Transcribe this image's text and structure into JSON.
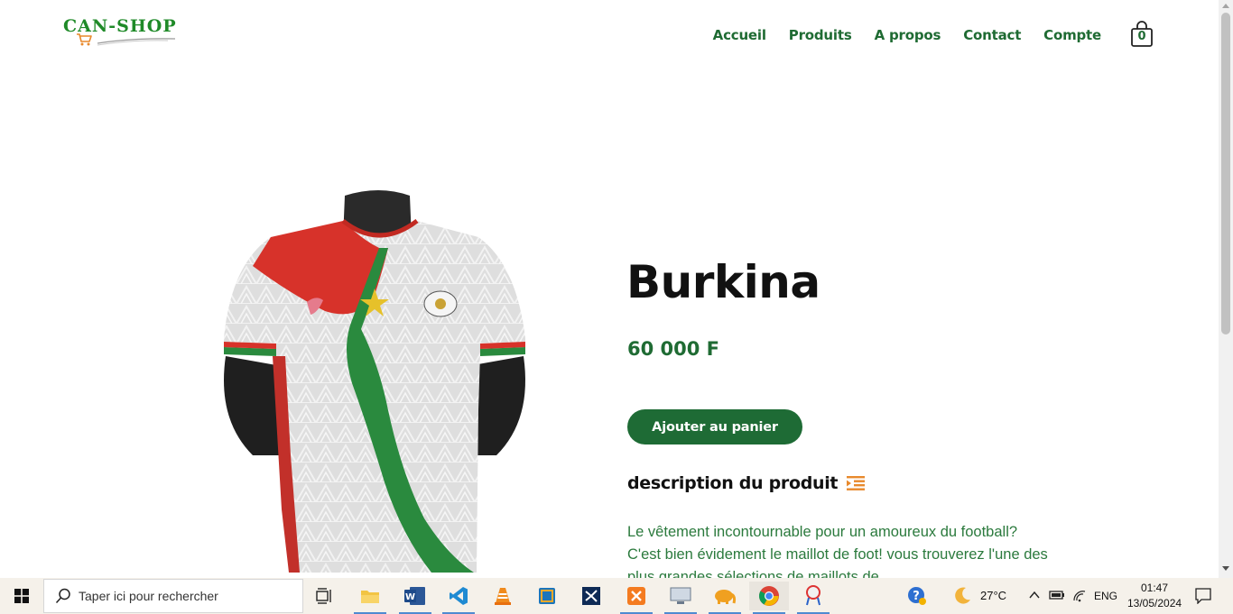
{
  "header": {
    "logo_text": "CAN-SHOP",
    "nav": [
      {
        "label": "Accueil"
      },
      {
        "label": "Produits"
      },
      {
        "label": "A propos"
      },
      {
        "label": "Contact"
      },
      {
        "label": "Compte"
      }
    ],
    "cart_count": "0",
    "icons": {
      "logo": "shopping-cart-icon",
      "cart": "shopping-bag-icon"
    }
  },
  "product": {
    "title": "Burkina",
    "price": "60 000 F",
    "add_to_cart_label": "Ajouter au panier",
    "description_heading": "description du produit",
    "description_icon": "indent-list-icon",
    "description_text": "Le vêtement incontournable pour un amoureux du football? C'est bien évidement le maillot de foot! vous trouverez l'une des plus grandes sélections de maillots de"
  },
  "taskbar": {
    "search_placeholder": "Taper ici pour rechercher",
    "weather_temp": "27°C",
    "language": "ENG",
    "time": "01:47",
    "date": "13/05/2024"
  },
  "colors": {
    "brand_green": "#1f6b33",
    "button_green": "#1e6b35",
    "logo_green": "#1f8a28",
    "accent_orange": "#e8892c"
  }
}
